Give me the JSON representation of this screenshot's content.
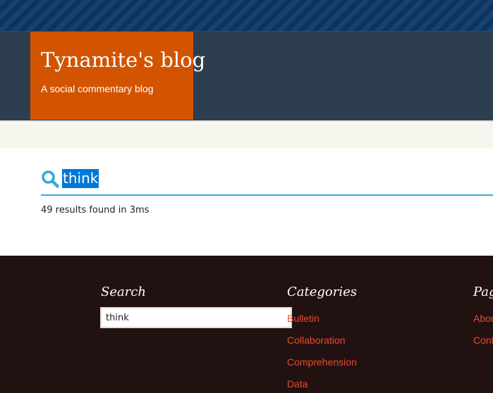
{
  "header": {
    "site_title": "Tynamite's blog",
    "tagline": "A social commentary blog"
  },
  "search": {
    "query": "think",
    "results_summary": "49 results found in 3ms"
  },
  "footer": {
    "search_title": "Search",
    "search_input_value": "think",
    "categories_title": "Categories",
    "categories": [
      "Bulletin",
      "Collaboration",
      "Comprehension",
      "Data"
    ],
    "pages_title": "Pag",
    "pages": [
      "Abou",
      "Cont"
    ]
  },
  "colors": {
    "top_band": "#0e3766",
    "header_bg": "#2c3e50",
    "brand_orange": "#d25400",
    "search_accent": "#33aadd",
    "selection": "#0078d7",
    "footer_bg": "#221111",
    "link": "#e84a2f"
  },
  "icons": {
    "search": "magnifier-icon"
  }
}
